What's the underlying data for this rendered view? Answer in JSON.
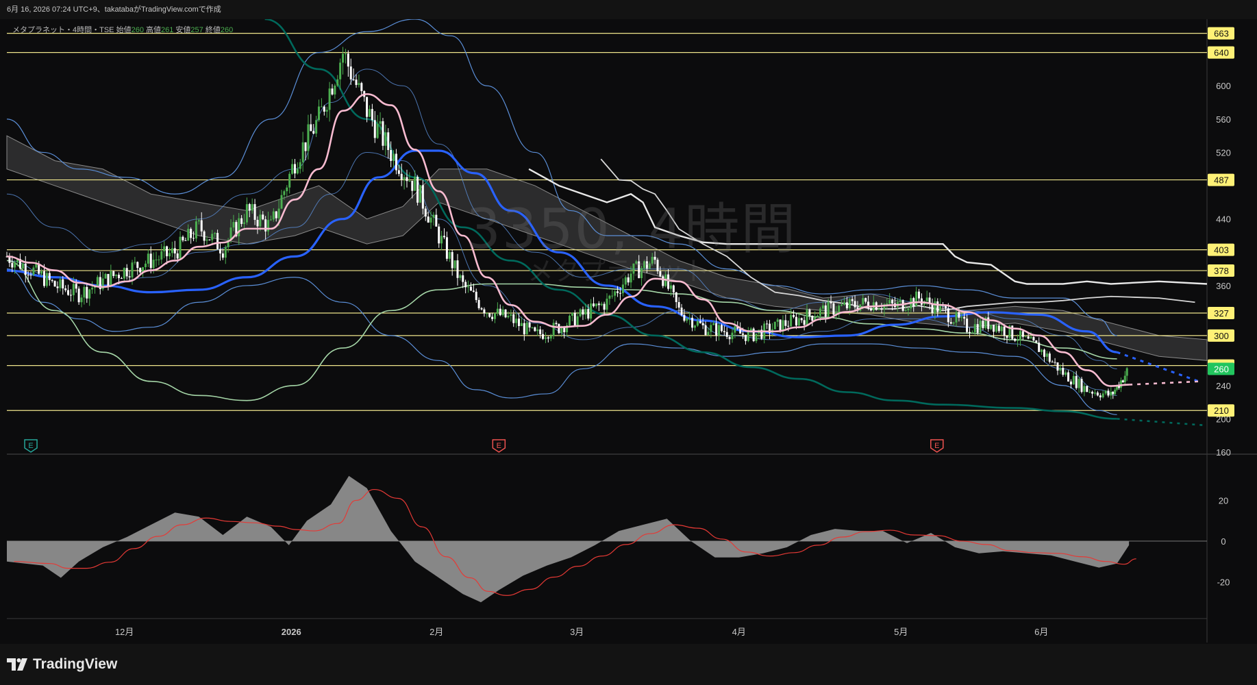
{
  "header": {
    "text": "6月 16, 2026 07:24 UTC+9、takatabaがTradingView.comで作成"
  },
  "legend": {
    "symbol": "メタプラネット・4時間・TSE",
    "open_label": "始値",
    "open_value": "260",
    "high_label": "高値",
    "high_value": "261",
    "low_label": "安値",
    "low_value": "257",
    "close_label": "終値",
    "close_value": "260"
  },
  "watermark": {
    "line1": "3350, 4時間",
    "line2": "メタプラネット"
  },
  "brand": {
    "name": "TradingView"
  },
  "colors": {
    "background": "#0c0c0d",
    "up": "#4caf50",
    "down": "#ffffff",
    "pink_ma": "#f8bbd0",
    "blue_ma": "#2962ff",
    "teal_ma": "#00695c",
    "lightgreen_ma": "#a5d6a7",
    "bollinger": "#5b8fd8",
    "cloud": "#6b6b6b",
    "hline": "#f0e68c",
    "label_bg": "#fff176",
    "current_price": "#22c55e",
    "oscillator_fill": "#9e9e9e",
    "oscillator_signal": "#e53935"
  },
  "chart_data": {
    "type": "line",
    "title": "メタプラネット・4時間・TSE",
    "price_axis": {
      "ylim": [
        160,
        680
      ],
      "ticks": [
        160,
        200,
        240,
        280,
        320,
        360,
        400,
        440,
        480,
        520,
        560,
        600
      ],
      "tick_labels": [
        "160",
        "200",
        "240",
        "",
        "",
        "360",
        "",
        "440",
        "",
        "520",
        "560",
        "600"
      ]
    },
    "x_axis": {
      "labels": [
        "12月",
        "2026",
        "2月",
        "3月",
        "4月",
        "5月",
        "6月"
      ],
      "label_positions": [
        0.098,
        0.237,
        0.358,
        0.475,
        0.61,
        0.745,
        0.862
      ]
    },
    "horizontal_levels": [
      663,
      640,
      487,
      403,
      378,
      327,
      300,
      264,
      210
    ],
    "current_price": 260,
    "candles_close_approx": [
      {
        "t": 0.0,
        "v": 395
      },
      {
        "t": 0.02,
        "v": 380
      },
      {
        "t": 0.04,
        "v": 360
      },
      {
        "t": 0.06,
        "v": 350
      },
      {
        "t": 0.08,
        "v": 365
      },
      {
        "t": 0.1,
        "v": 380
      },
      {
        "t": 0.12,
        "v": 390
      },
      {
        "t": 0.14,
        "v": 400
      },
      {
        "t": 0.16,
        "v": 430
      },
      {
        "t": 0.18,
        "v": 405
      },
      {
        "t": 0.2,
        "v": 450
      },
      {
        "t": 0.22,
        "v": 430
      },
      {
        "t": 0.24,
        "v": 510
      },
      {
        "t": 0.26,
        "v": 560
      },
      {
        "t": 0.28,
        "v": 640
      },
      {
        "t": 0.3,
        "v": 570
      },
      {
        "t": 0.32,
        "v": 520
      },
      {
        "t": 0.34,
        "v": 480
      },
      {
        "t": 0.36,
        "v": 420
      },
      {
        "t": 0.38,
        "v": 360
      },
      {
        "t": 0.4,
        "v": 330
      },
      {
        "t": 0.42,
        "v": 320
      },
      {
        "t": 0.44,
        "v": 300
      },
      {
        "t": 0.46,
        "v": 310
      },
      {
        "t": 0.48,
        "v": 325
      },
      {
        "t": 0.5,
        "v": 340
      },
      {
        "t": 0.52,
        "v": 375
      },
      {
        "t": 0.54,
        "v": 390
      },
      {
        "t": 0.56,
        "v": 330
      },
      {
        "t": 0.58,
        "v": 310
      },
      {
        "t": 0.6,
        "v": 305
      },
      {
        "t": 0.62,
        "v": 300
      },
      {
        "t": 0.64,
        "v": 310
      },
      {
        "t": 0.66,
        "v": 320
      },
      {
        "t": 0.68,
        "v": 330
      },
      {
        "t": 0.7,
        "v": 335
      },
      {
        "t": 0.72,
        "v": 340
      },
      {
        "t": 0.74,
        "v": 335
      },
      {
        "t": 0.76,
        "v": 345
      },
      {
        "t": 0.78,
        "v": 330
      },
      {
        "t": 0.8,
        "v": 310
      },
      {
        "t": 0.82,
        "v": 315
      },
      {
        "t": 0.84,
        "v": 300
      },
      {
        "t": 0.86,
        "v": 285
      },
      {
        "t": 0.88,
        "v": 255
      },
      {
        "t": 0.9,
        "v": 235
      },
      {
        "t": 0.92,
        "v": 228
      },
      {
        "t": 0.935,
        "v": 260
      }
    ],
    "oscillator": {
      "ylim": [
        -38,
        42
      ],
      "ticks": [
        20,
        0,
        -20
      ],
      "tick_labels": [
        "20",
        "0",
        "-20"
      ],
      "values": [
        {
          "t": 0.0,
          "v": -10
        },
        {
          "t": 0.03,
          "v": -12
        },
        {
          "t": 0.045,
          "v": -18
        },
        {
          "t": 0.06,
          "v": -10
        },
        {
          "t": 0.08,
          "v": -3
        },
        {
          "t": 0.1,
          "v": 2
        },
        {
          "t": 0.12,
          "v": 8
        },
        {
          "t": 0.14,
          "v": 14
        },
        {
          "t": 0.16,
          "v": 12
        },
        {
          "t": 0.18,
          "v": 3
        },
        {
          "t": 0.2,
          "v": 12
        },
        {
          "t": 0.22,
          "v": 7
        },
        {
          "t": 0.235,
          "v": -2
        },
        {
          "t": 0.25,
          "v": 10
        },
        {
          "t": 0.27,
          "v": 18
        },
        {
          "t": 0.285,
          "v": 32
        },
        {
          "t": 0.3,
          "v": 26
        },
        {
          "t": 0.32,
          "v": 5
        },
        {
          "t": 0.34,
          "v": -10
        },
        {
          "t": 0.36,
          "v": -18
        },
        {
          "t": 0.38,
          "v": -26
        },
        {
          "t": 0.395,
          "v": -30
        },
        {
          "t": 0.41,
          "v": -24
        },
        {
          "t": 0.43,
          "v": -17
        },
        {
          "t": 0.45,
          "v": -12
        },
        {
          "t": 0.47,
          "v": -8
        },
        {
          "t": 0.49,
          "v": -2
        },
        {
          "t": 0.51,
          "v": 5
        },
        {
          "t": 0.53,
          "v": 8
        },
        {
          "t": 0.55,
          "v": 11
        },
        {
          "t": 0.57,
          "v": 0
        },
        {
          "t": 0.59,
          "v": -8
        },
        {
          "t": 0.61,
          "v": -8
        },
        {
          "t": 0.63,
          "v": -6
        },
        {
          "t": 0.65,
          "v": -3
        },
        {
          "t": 0.67,
          "v": 3
        },
        {
          "t": 0.69,
          "v": 6
        },
        {
          "t": 0.71,
          "v": 5
        },
        {
          "t": 0.73,
          "v": 5
        },
        {
          "t": 0.75,
          "v": -1
        },
        {
          "t": 0.77,
          "v": 4
        },
        {
          "t": 0.79,
          "v": -3
        },
        {
          "t": 0.81,
          "v": -6
        },
        {
          "t": 0.83,
          "v": -5
        },
        {
          "t": 0.85,
          "v": -6
        },
        {
          "t": 0.87,
          "v": -7
        },
        {
          "t": 0.89,
          "v": -10
        },
        {
          "t": 0.91,
          "v": -13
        },
        {
          "t": 0.925,
          "v": -11
        },
        {
          "t": 0.935,
          "v": -2
        }
      ]
    }
  }
}
